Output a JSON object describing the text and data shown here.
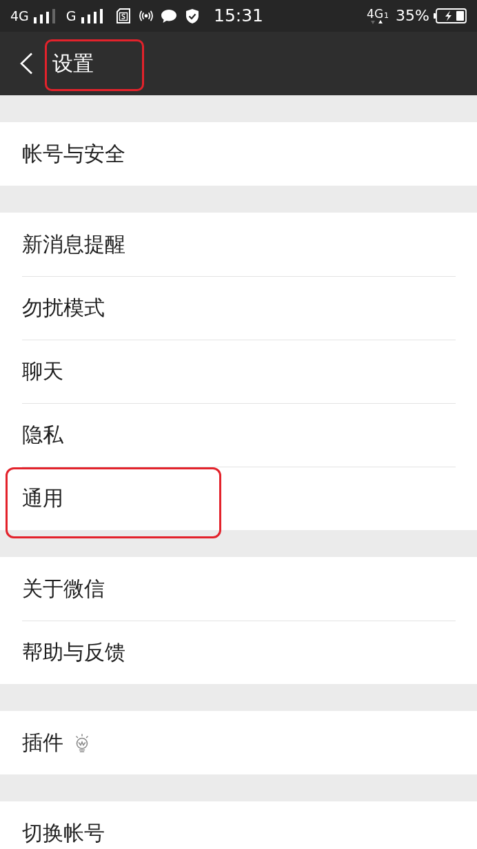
{
  "status_bar": {
    "sim1_network": "4G",
    "sim2_network": "G",
    "time": "15:31",
    "data_network": "4G",
    "data_sim": "1",
    "battery": "35%"
  },
  "header": {
    "title": "设置",
    "highlighted": true
  },
  "groups": [
    {
      "items": [
        {
          "label": "帐号与安全",
          "kind": "plain",
          "highlighted": false
        }
      ]
    },
    {
      "items": [
        {
          "label": "新消息提醒",
          "kind": "plain",
          "highlighted": false
        },
        {
          "label": "勿扰模式",
          "kind": "plain",
          "highlighted": false
        },
        {
          "label": "聊天",
          "kind": "plain",
          "highlighted": false
        },
        {
          "label": "隐私",
          "kind": "plain",
          "highlighted": false
        },
        {
          "label": "通用",
          "kind": "plain",
          "highlighted": true
        }
      ]
    },
    {
      "items": [
        {
          "label": "关于微信",
          "kind": "plain",
          "highlighted": false
        },
        {
          "label": "帮助与反馈",
          "kind": "plain",
          "highlighted": false
        }
      ]
    },
    {
      "items": [
        {
          "label": "插件",
          "kind": "icon",
          "highlighted": false
        }
      ]
    },
    {
      "items": [
        {
          "label": "切换帐号",
          "kind": "plain",
          "highlighted": false
        }
      ]
    }
  ]
}
